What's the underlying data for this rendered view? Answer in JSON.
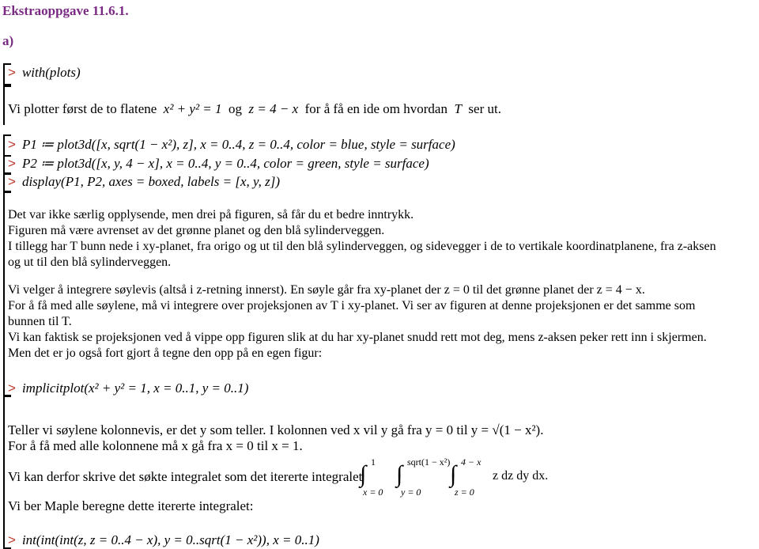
{
  "document": {
    "title": "Ekstraoppgave 11.6.1.",
    "section": "a)"
  },
  "prompt_symbol": ">",
  "commands": {
    "with_plots": "with(plots)",
    "p1": "P1 ≔ plot3d([x, sqrt(1 − x²), z], x = 0..4, z = 0..4, color = blue, style = surface)",
    "p2": "P2 ≔ plot3d([x, y, 4 − x], x = 0..4, y = 0..4, color = green, style = surface)",
    "display": "display(P1, P2, axes = boxed, labels = [x, y, z])",
    "implicitplot": "implicitplot(x² + y² = 1, x = 0..1, y = 0..1)",
    "int": "int(int(int(z, z = 0..4 − x), y = 0..sqrt(1 − x²)), x = 0..1)"
  },
  "text": {
    "intro_a": "Vi plotter først de to flatene",
    "intro_eq1": "x² + y² = 1",
    "intro_og": "og",
    "intro_eq2": "z = 4 − x",
    "intro_b": "for å få en ide om hvordan",
    "intro_T": "T",
    "intro_c": "ser ut.",
    "p1_line1": "Det var ikke særlig opplysende, men drei på figuren, så får du et bedre inntrykk.",
    "p1_line2": "Figuren må være avrenset av det grønne planet og den blå sylinderveggen.",
    "p1_line3": "I tillegg har  T  bunn nede i  xy-planet, fra origo og ut til den blå sylinderveggen, og sidevegger i de to vertikale koordinatplanene, fra  z-aksen",
    "p1_line4": "og ut til den blå sylinderveggen.",
    "p2_line1": "Vi velger å integrere søylevis (altså i  z-retning innerst). En søyle går fra  xy-planet der  z = 0  til det grønne planet der  z = 4 − x.",
    "p2_line2": "For å få med alle søylene, må vi integrere over projeksjonen av  T  i  xy-planet. Vi ser av figuren at denne projeksjonen er det samme som",
    "p2_line3": "bunnen til  T.",
    "p2_line4": "Vi kan faktisk se projeksjonen ved å vippe opp figuren slik at du har  xy-planet snudd rett mot deg, mens  z-aksen peker rett inn i skjermen.",
    "p2_line5": "Men det er jo også fort gjort å tegne den opp på en egen figur:",
    "p3_line1": "Teller vi søylene kolonnevis, er det  y  som teller. I kolonnen ved  x  vil  y  gå fra  y = 0  til  y = √(1 − x²).",
    "p3_line2": "For å få med alle kolonnene må  x  gå fra  x = 0  til  x = 1.",
    "p4_line": "Vi kan derfor skrive det søkte integralet som det itererte integralet",
    "p5_line": "Vi ber Maple beregne dette itererte integralet:"
  },
  "integral": {
    "outer_upper": "1",
    "outer_lower": "x = 0",
    "middle_upper": "sqrt(1 − x²)",
    "middle_lower": "y = 0",
    "inner_upper": "4 − x",
    "inner_lower": "z = 0",
    "integrand": "z dz dy dx."
  },
  "colors": {
    "title": "#7b2a84",
    "prompt": "#c0392b"
  }
}
